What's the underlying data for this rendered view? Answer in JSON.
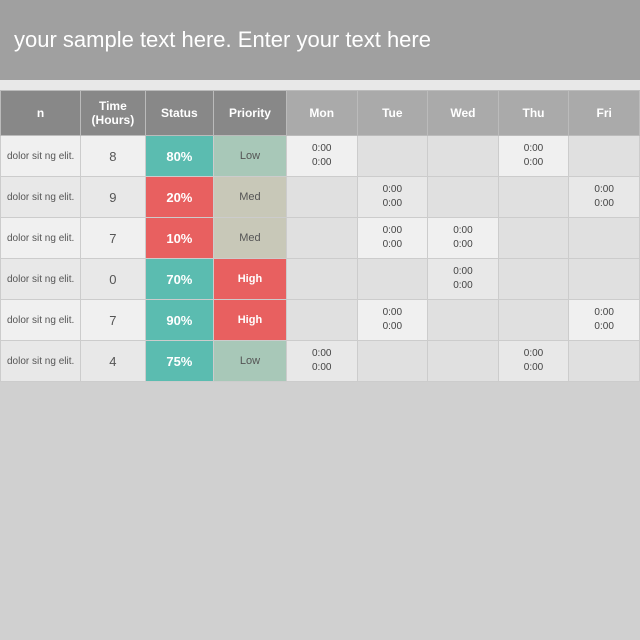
{
  "banner": {
    "text": "your sample text here. Enter your text here"
  },
  "table": {
    "headers": {
      "name": "n",
      "time": "Time (Hours)",
      "status": "Status",
      "priority": "Priority",
      "days": [
        "Mon",
        "Tue",
        "Wed",
        "Thu",
        "Fri"
      ]
    },
    "rows": [
      {
        "name": "dolor sit ng elit.",
        "time": "8",
        "status_pct": "80%",
        "status_type": "teal",
        "priority": "Low",
        "priority_type": "low",
        "mon": "0:00 - 0:00",
        "tue": "",
        "wed": "",
        "thu": "0:00 - 0:00",
        "fri": ""
      },
      {
        "name": "dolor sit ng elit.",
        "time": "9",
        "status_pct": "20%",
        "status_type": "red",
        "priority": "Med",
        "priority_type": "med",
        "mon": "",
        "tue": "0:00 - 0:00",
        "wed": "",
        "thu": "",
        "fri": "0:00 - 0:00"
      },
      {
        "name": "dolor sit ng elit.",
        "time": "7",
        "status_pct": "10%",
        "status_type": "red",
        "priority": "Med",
        "priority_type": "med",
        "mon": "",
        "tue": "0:00 - 0:00",
        "wed": "0:00 - 0:00",
        "thu": "",
        "fri": ""
      },
      {
        "name": "dolor sit ng elit.",
        "time": "0",
        "status_pct": "70%",
        "status_type": "teal",
        "priority": "High",
        "priority_type": "high",
        "mon": "",
        "tue": "",
        "wed": "0:00 - 0:00",
        "thu": "",
        "fri": ""
      },
      {
        "name": "dolor sit ng elit.",
        "time": "7",
        "status_pct": "90%",
        "status_type": "teal",
        "priority": "High",
        "priority_type": "high",
        "mon": "",
        "tue": "0:00 - 0:00",
        "wed": "",
        "thu": "",
        "fri": "0:00 - 0:00"
      },
      {
        "name": "dolor sit ng elit.",
        "time": "4",
        "status_pct": "75%",
        "status_type": "teal",
        "priority": "Low",
        "priority_type": "low",
        "mon": "0:00 - 0:00",
        "tue": "",
        "wed": "",
        "thu": "0:00 - 0:00",
        "fri": ""
      }
    ]
  }
}
